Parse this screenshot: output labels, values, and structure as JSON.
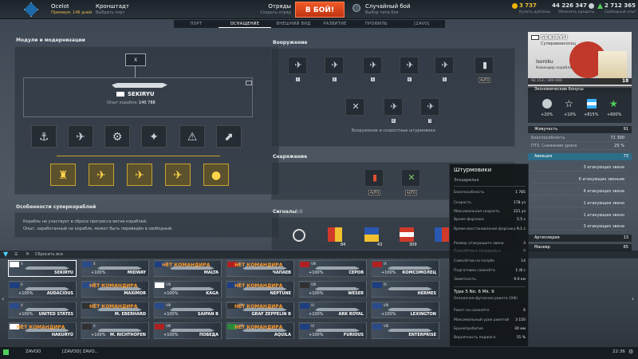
{
  "top": {
    "player_name": "Ocelot",
    "premium": "Премиум: 146 дней",
    "port_name": "Кронштадт",
    "port_sub": "Выбрать порт",
    "squad_label": "Отряды",
    "squad_sub": "Создать отряд",
    "battle_button": "В БОЙ!",
    "battle_type": "Случайный бой",
    "battle_type_sub": "Выбор типа боя",
    "gold": "3 737",
    "gold_sub": "Купить дублоны",
    "credits": "44 226 347",
    "credits_sub": "Обменять кредиты",
    "freexp": "2 712 365",
    "freexp_sub": "Свободный опыт"
  },
  "nav": {
    "tabs": [
      "ПОРТ",
      "ОСНАЩЕНИЕ",
      "ВНЕШНИЙ ВИД",
      "РАЗВИТИЕ",
      "ПРОФИЛЬ",
      "[ZAVO]"
    ],
    "active": "ОСНАЩЕНИЕ"
  },
  "modules": {
    "title": "Модули и модернизации",
    "ship_name": "SEKIRYU",
    "ship_xp_label": "Опыт корабля:",
    "ship_xp_value": "140 788",
    "top_slot_label": "X"
  },
  "superships": {
    "title": "Особенности суперкораблей",
    "bullets": [
      "Корабль не участвует в сбросе прогресса ветки кораблей.",
      "Опыт, заработанный на корабле, может быть переведён в свободный."
    ]
  },
  "armament": {
    "title": "Вооружение",
    "slots": [
      "1",
      "2",
      "3",
      "4",
      "5",
      "AUTO"
    ],
    "hint": "Вооружение и скоростные штурмовики",
    "sub_badges": [
      "R",
      "T"
    ]
  },
  "consumables": {
    "title": "Снаряжение",
    "items": [
      "AUTO",
      "AUTO"
    ]
  },
  "signals": {
    "title": "Сигналы",
    "count": "3/8",
    "items": [
      {
        "count": "84",
        "ttl": "16:000"
      },
      {
        "count": "43",
        "ttl": "24:000"
      },
      {
        "count": "309",
        "ttl": "12:000"
      },
      {
        "count": "2",
        "ttl": "12:000"
      }
    ]
  },
  "tooltip": {
    "title": "Штурмовики",
    "subtitle": "Эскадрилья",
    "rows": [
      [
        "Боеспособность",
        "1 785"
      ],
      [
        "Скорость",
        "178 уз"
      ],
      [
        "Максимальная скорость",
        "221 уз"
      ],
      [
        "Время форсажа",
        "5.5 с"
      ],
      [
        "Время восстановления форсажа",
        "9.1 с"
      ],
      [
        "Размер атакующего звена",
        "3"
      ],
      [
        "Самолётов в эскадрилье",
        "9"
      ],
      [
        "Самолётов на палубе",
        "14"
      ],
      [
        "Подготовка самолёта",
        "1 /8 с"
      ],
      [
        "Заметность",
        "9.0 км"
      ]
    ],
    "weapon_title": "Type 5 No. 6 Mk. 9",
    "weapon_sub": "Осколочно-фугасная ракета (ОФ)",
    "weapon_rows": [
      [
        "Ракет на самолёте",
        "6"
      ],
      [
        "Максимальный урон ракетой",
        "3 150"
      ],
      [
        "Бронепробитие",
        "30 мм"
      ],
      [
        "Вероятность поджога",
        "15 %"
      ]
    ]
  },
  "right": {
    "ship_name": "SEKIRYU",
    "ship_sub": "Суперавианосец",
    "commander": "Isoroku",
    "commander_sub": "Командир корабля",
    "commander_xp": "92 153 / 300 000",
    "commander_level": "18",
    "eco_title": "Экономические бонусы",
    "eco": [
      "+20%",
      "+10%",
      "+815%",
      "+600%"
    ],
    "stats_title": "Живучесть",
    "stats_value": "91",
    "stats": [
      [
        "Боеспособность",
        "71 300"
      ],
      [
        "ПТЗ. Снижение урона",
        "25 %"
      ]
    ],
    "aviation_title": "Авиация",
    "aviation_value": "73",
    "aviation": [
      [
        "Штурмовики\nRikufu",
        "3 атакующих звена"
      ],
      [
        "Штурмовики\nTenrai",
        "6 атакующих звеньев"
      ],
      [
        "Пикирующие\nTenrai",
        "4 атакующих звена"
      ],
      [
        "Пикирующие\nRyusei J7W3",
        "1 атакующее звено"
      ],
      [
        "Торпедоносцы\nRyusei R2Y2",
        "1 атакующее звено"
      ],
      [
        "",
        "3 атакующих звена"
      ]
    ],
    "tail1_label": "Артиллерия",
    "tail1_value": "13",
    "tail2_label": "Маневр",
    "tail2_value": "65"
  },
  "filter": {
    "reset": "Сбросить все"
  },
  "ships": [
    {
      "name": "SEKIRYU",
      "tier": "X",
      "pct": "",
      "nocap": false,
      "flag": "jp",
      "sel": true
    },
    {
      "name": "MIDWAY",
      "tier": "X",
      "pct": "+100%",
      "nocap": false,
      "flag": "us"
    },
    {
      "name": "MALTA",
      "tier": "X",
      "pct": "",
      "nocap": true,
      "flag": "uk"
    },
    {
      "name": "ЧАПАЕВ",
      "tier": "X",
      "pct": "",
      "nocap": true,
      "flag": "ussr"
    },
    {
      "name": "СЕРОВ",
      "tier": "VIII",
      "pct": "+100%",
      "nocap": false,
      "flag": "ussr"
    },
    {
      "name": "КОМСОМОЛЕЦ",
      "tier": "IX",
      "pct": "+100%",
      "nocap": false,
      "flag": "ussr"
    },
    {
      "name": "AUDACIOUS",
      "tier": "X",
      "pct": "+100%",
      "nocap": false,
      "flag": "uk"
    },
    {
      "name": "MAXIMOR",
      "tier": "X",
      "pct": "",
      "nocap": true,
      "flag": "us"
    },
    {
      "name": "KAGA",
      "tier": "VIII",
      "pct": "+100%",
      "nocap": false,
      "flag": "jp"
    },
    {
      "name": "NEPTUNE",
      "tier": "X",
      "pct": "",
      "nocap": true,
      "flag": "uk"
    },
    {
      "name": "WESER",
      "tier": "VIII",
      "pct": "+100%",
      "nocap": false,
      "flag": "de"
    },
    {
      "name": "HERMES",
      "tier": "IV",
      "pct": "",
      "nocap": false,
      "flag": "uk"
    },
    {
      "name": "UNITED STATES",
      "tier": "X",
      "pct": "+100%",
      "nocap": false,
      "flag": "us"
    },
    {
      "name": "M. EBERHARD",
      "tier": "X",
      "pct": "",
      "nocap": true,
      "flag": "de"
    },
    {
      "name": "SAIPAN B",
      "tier": "VIII",
      "pct": "+100%",
      "nocap": false,
      "flag": "us"
    },
    {
      "name": "GRAF ZEPPELIN B",
      "tier": "VIII",
      "pct": "",
      "nocap": true,
      "flag": "de"
    },
    {
      "name": "ARK ROYAL",
      "tier": "VI",
      "pct": "+100%",
      "nocap": false,
      "flag": "uk"
    },
    {
      "name": "LEXINGTON",
      "tier": "VIII",
      "pct": "+100%",
      "nocap": false,
      "flag": "us"
    },
    {
      "name": "HAKURYŪ",
      "tier": "X",
      "pct": "",
      "nocap": true,
      "flag": "jp"
    },
    {
      "name": "M. RICHTHOFEN",
      "tier": "X",
      "pct": "+100%",
      "nocap": false,
      "flag": "de"
    },
    {
      "name": "ПОБЕДА",
      "tier": "VIII",
      "pct": "+100%",
      "nocap": false,
      "flag": "ussr"
    },
    {
      "name": "AQUILA",
      "tier": "VIII",
      "pct": "",
      "nocap": true,
      "flag": "it"
    },
    {
      "name": "FURIOUS",
      "tier": "VI",
      "pct": "+100%",
      "nocap": false,
      "flag": "uk"
    },
    {
      "name": "ENTERPRISE",
      "tier": "VIII",
      "pct": "",
      "nocap": false,
      "flag": "us"
    }
  ],
  "nocap_label": "НЕТ КОМАНДИРА",
  "bottom": {
    "clan": "ZAVOD",
    "chat": "[ZAVOD] ZAVO...",
    "time": "22:36"
  },
  "colors": {
    "battle": "#d8411b",
    "gold_icon": "#f0b400",
    "credits_icon": "#c9ced2",
    "freexp_icon": "#4fcf5a",
    "nocap": "#ff9a2a"
  }
}
